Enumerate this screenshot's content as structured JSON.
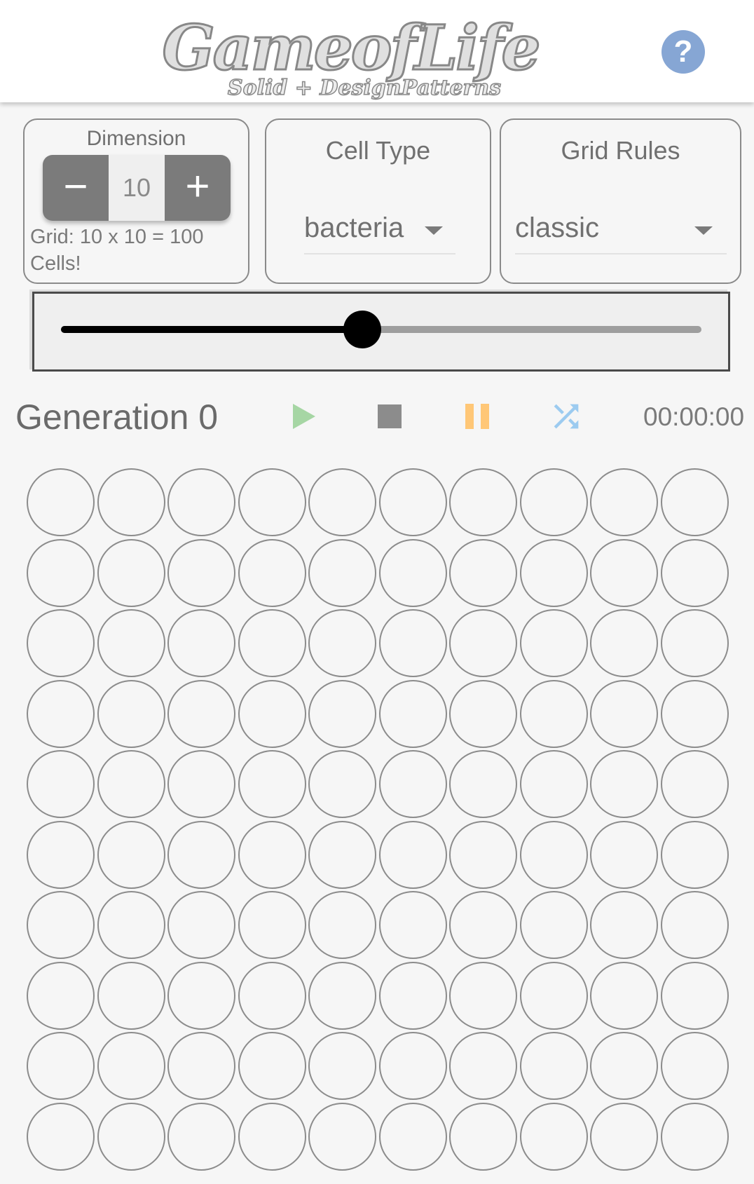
{
  "header": {
    "logo_title": "GameofLife",
    "logo_subtitle": "Solid + DesignPatterns",
    "help_symbol": "?"
  },
  "dimension": {
    "label": "Dimension",
    "value": "10",
    "minus_symbol": "−",
    "plus_symbol": "+",
    "grid_info": "Grid: 10 x 10 = 100 Cells!"
  },
  "cell_type": {
    "label": "Cell Type",
    "selected": "bacteria"
  },
  "grid_rules": {
    "label": "Grid Rules",
    "selected": "classic"
  },
  "speed_slider": {
    "value": 0.47
  },
  "status": {
    "generation": "Generation 0",
    "timer": "00:00:00"
  },
  "controls": {
    "play_icon": "play-icon",
    "stop_icon": "stop-icon",
    "pause_icon": "pause-icon",
    "shuffle_icon": "shuffle-icon",
    "play_color": "#a6d6a4",
    "stop_color": "#8c8c8c",
    "pause_color": "#ffc777",
    "shuffle_color": "#9ccbf0",
    "help_color": "#86a6d4"
  },
  "board": {
    "rows": 10,
    "cols": 10
  }
}
